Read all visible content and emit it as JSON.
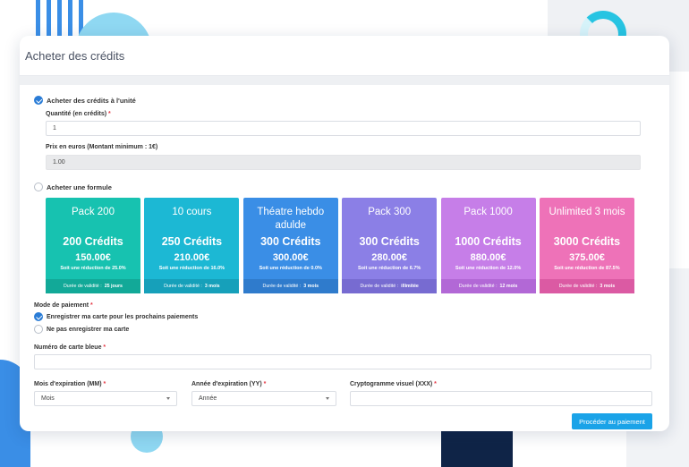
{
  "page": {
    "title": "Acheter des crédits"
  },
  "unit": {
    "option_label": "Acheter des crédits à l'unité",
    "quantity_label": "Quantité (en crédits)",
    "quantity_value": "1",
    "price_label": "Prix en euros (Montant minimum : 1€)",
    "price_value": "1.00"
  },
  "formula": {
    "option_label": "Acheter une formule"
  },
  "plans": [
    {
      "name": "Pack 200",
      "credits": "200 Crédits",
      "price": "150.00€",
      "reduction": "Soit une réduction de 25.0%",
      "validity_label": "Durée de validité :",
      "validity": "25 jours",
      "color": "#17c2b0",
      "footer_color": "#12a998"
    },
    {
      "name": "10 cours",
      "credits": "250 Crédits",
      "price": "210.00€",
      "reduction": "Soit une réduction de 16.0%",
      "validity_label": "Durée de validité :",
      "validity": "3 mois",
      "color": "#1cb8d4",
      "footer_color": "#16a0ba"
    },
    {
      "name": "Théatre hebdo adulde",
      "credits": "300 Crédits",
      "price": "300.00€",
      "reduction": "Soit une réduction de 0.0%",
      "validity_label": "Durée de validité :",
      "validity": "3 mois",
      "color": "#3a8ee6",
      "footer_color": "#2f7bcc"
    },
    {
      "name": "Pack 300",
      "credits": "300 Crédits",
      "price": "280.00€",
      "reduction": "Soit une réduction de 6.7%",
      "validity_label": "Durée de validité :",
      "validity": "illimitée",
      "color": "#8b7fe6",
      "footer_color": "#776bd1"
    },
    {
      "name": "Pack 1000",
      "credits": "1000 Crédits",
      "price": "880.00€",
      "reduction": "Soit une réduction de 12.0%",
      "validity_label": "Durée de validité :",
      "validity": "12 mois",
      "color": "#c67ee8",
      "footer_color": "#b268d6"
    },
    {
      "name": "Unlimited 3 mois",
      "credits": "3000 Crédits",
      "price": "375.00€",
      "reduction": "Soit une réduction de 87.5%",
      "validity_label": "Durée de validité :",
      "validity": "3 mois",
      "color": "#ee72b8",
      "footer_color": "#db5aa3"
    }
  ],
  "payment": {
    "mode_label": "Mode de paiement",
    "save_card_label": "Enregistrer ma carte pour les prochains paiements",
    "no_save_card_label": "Ne pas enregistrer ma carte",
    "card_number_label": "Numéro de carte bleue",
    "card_number_value": "",
    "exp_month_label": "Mois d'expiration (MM)",
    "exp_month_value": "Mois",
    "exp_year_label": "Année d'expiration (YY)",
    "exp_year_value": "Année",
    "cvv_label": "Cryptogramme visuel (XXX)",
    "cvv_value": "",
    "submit_label": "Procéder au paiement"
  },
  "required_mark": "*",
  "colors": {
    "accent": "#1aa3e8",
    "checkbox": "#2a7cd6",
    "required": "#e53946"
  }
}
